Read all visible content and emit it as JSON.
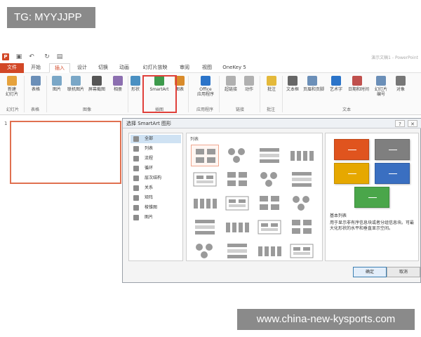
{
  "watermarks": {
    "top": "TG: MYYJJPP",
    "bottom": "www.china-new-kysports.com"
  },
  "window": {
    "title": "演示文稿1 - PowerPoint",
    "app_logo": "P"
  },
  "ribbon_tabs": [
    "文件",
    "开始",
    "插入",
    "设计",
    "切换",
    "动画",
    "幻灯片放映",
    "审阅",
    "视图",
    "OneKey 5"
  ],
  "active_tab": "插入",
  "ribbon_buttons": [
    {
      "label": "新建\n幻灯片",
      "icon": "new-slide-icon",
      "color": "#e6a23c"
    },
    {
      "label": "表格",
      "icon": "table-icon",
      "color": "#6b8fb8"
    },
    {
      "label": "图片",
      "icon": "picture-icon",
      "color": "#7aa7c7"
    },
    {
      "label": "联机图片",
      "icon": "online-picture-icon",
      "color": "#7aa7c7"
    },
    {
      "label": "屏幕截图",
      "icon": "screenshot-icon",
      "color": "#555555"
    },
    {
      "label": "相册",
      "icon": "album-icon",
      "color": "#8c6fb0"
    },
    {
      "label": "形状",
      "icon": "shapes-icon",
      "color": "#4a90c2"
    },
    {
      "label": "SmartArt",
      "icon": "smartart-icon",
      "color": "#3d9a4c"
    },
    {
      "label": "图表",
      "icon": "chart-icon",
      "color": "#d98b2b"
    },
    {
      "label": "Office\n应用程序",
      "icon": "office-apps-icon",
      "color": "#2b74c9"
    },
    {
      "label": "超链接",
      "icon": "hyperlink-icon",
      "color": "#b0b0b0"
    },
    {
      "label": "动作",
      "icon": "action-icon",
      "color": "#b0b0b0"
    },
    {
      "label": "批注",
      "icon": "comment-icon",
      "color": "#e4b93a"
    },
    {
      "label": "文本框",
      "icon": "textbox-icon",
      "color": "#666666"
    },
    {
      "label": "页眉和页脚",
      "icon": "header-footer-icon",
      "color": "#6b8fb8"
    },
    {
      "label": "艺术字",
      "icon": "wordart-icon",
      "color": "#2b74c9"
    },
    {
      "label": "日期和时间",
      "icon": "datetime-icon",
      "color": "#c0504d"
    },
    {
      "label": "幻灯片\n编号",
      "icon": "slide-number-icon",
      "color": "#6b8fb8"
    },
    {
      "label": "对象",
      "icon": "object-icon",
      "color": "#777777"
    }
  ],
  "ribbon_groups": [
    "幻灯片",
    "表格",
    "图像",
    "插图",
    "应用程序",
    "链接",
    "批注",
    "文本"
  ],
  "thumbnail": {
    "number": "1"
  },
  "dialog": {
    "title": "选择 SmartArt 图形",
    "controls": [
      "?",
      "✕"
    ],
    "categories": [
      "全部",
      "列表",
      "流程",
      "循环",
      "层次结构",
      "关系",
      "矩阵",
      "棱锥图",
      "图片"
    ],
    "selected_category": "全部",
    "gallery_header": "列表",
    "preview_title": "基本列表",
    "preview_desc": "用于显示非有序信息块或者分组信息块。可最大化形状的水平和垂直显示空间。",
    "preview_colors": [
      "#e0541e",
      "#7f7f7f",
      "#e6a800",
      "#3a6fc1",
      "#4aa64a"
    ],
    "buttons": {
      "ok": "确定",
      "cancel": "取消"
    }
  }
}
